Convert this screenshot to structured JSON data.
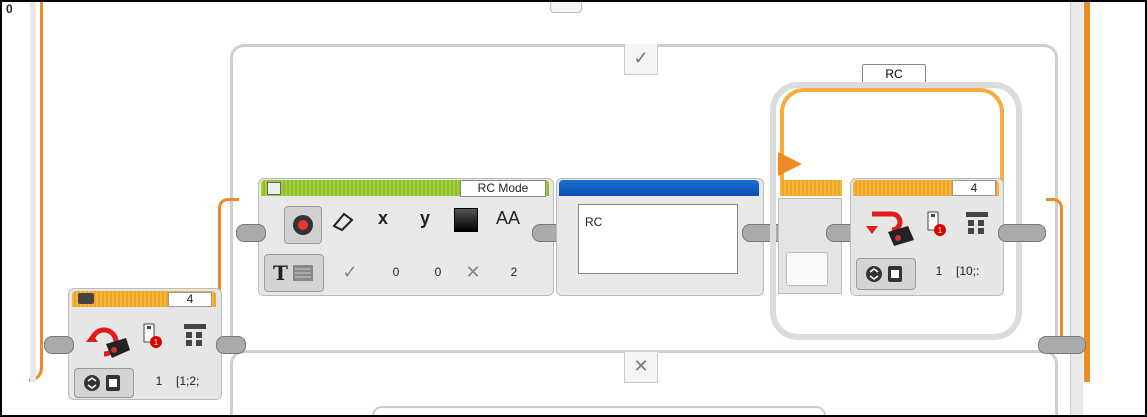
{
  "corner_label": "0",
  "switch_case": {
    "true_tab": "✓",
    "false_tab": "✕"
  },
  "loop": {
    "name": "RC"
  },
  "display_block": {
    "mode_label": "RC Mode",
    "params_header": [
      "x",
      "y",
      "AA"
    ],
    "x_value": "0",
    "y_value": "0",
    "font_value": "2"
  },
  "text_block": {
    "text": "RC"
  },
  "remote_block_left": {
    "port": "4",
    "channel": "1",
    "value": "[1;2;"
  },
  "remote_block_right": {
    "port": "4",
    "channel": "1",
    "value": "[10;:"
  },
  "colors": {
    "wire": "#f08a24",
    "frame": "#c8c8c8",
    "green_bar": "#a2cf3c",
    "orange_bar": "#f7b53c",
    "blue_bar": "#1a6fd3"
  }
}
